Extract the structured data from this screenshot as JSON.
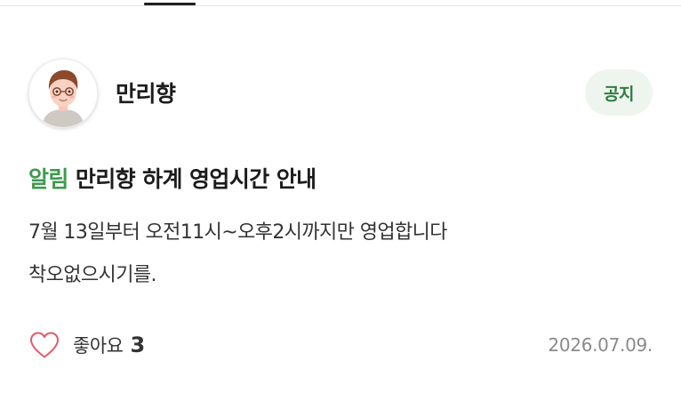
{
  "post": {
    "author": "만리향",
    "badge": "공지",
    "title_tag": "알림",
    "title": "만리향 하계 영업시간 안내",
    "body_lines": [
      "7월 13일부터 오전11시~오후2시까지만 영업합니다",
      "착오없으시기를."
    ],
    "date": "2026.07.09."
  },
  "actions": {
    "like_label": "좋아요",
    "like_count": "3"
  },
  "icons": {
    "avatar": "profile-avatar-icon",
    "like": "heart-outline-icon"
  },
  "colors": {
    "accent_green": "#3f9a4f",
    "badge_bg": "#eef5ef",
    "badge_text": "#2e7d3f",
    "heart": "#e05a6b",
    "date_gray": "#8a8a8a"
  }
}
